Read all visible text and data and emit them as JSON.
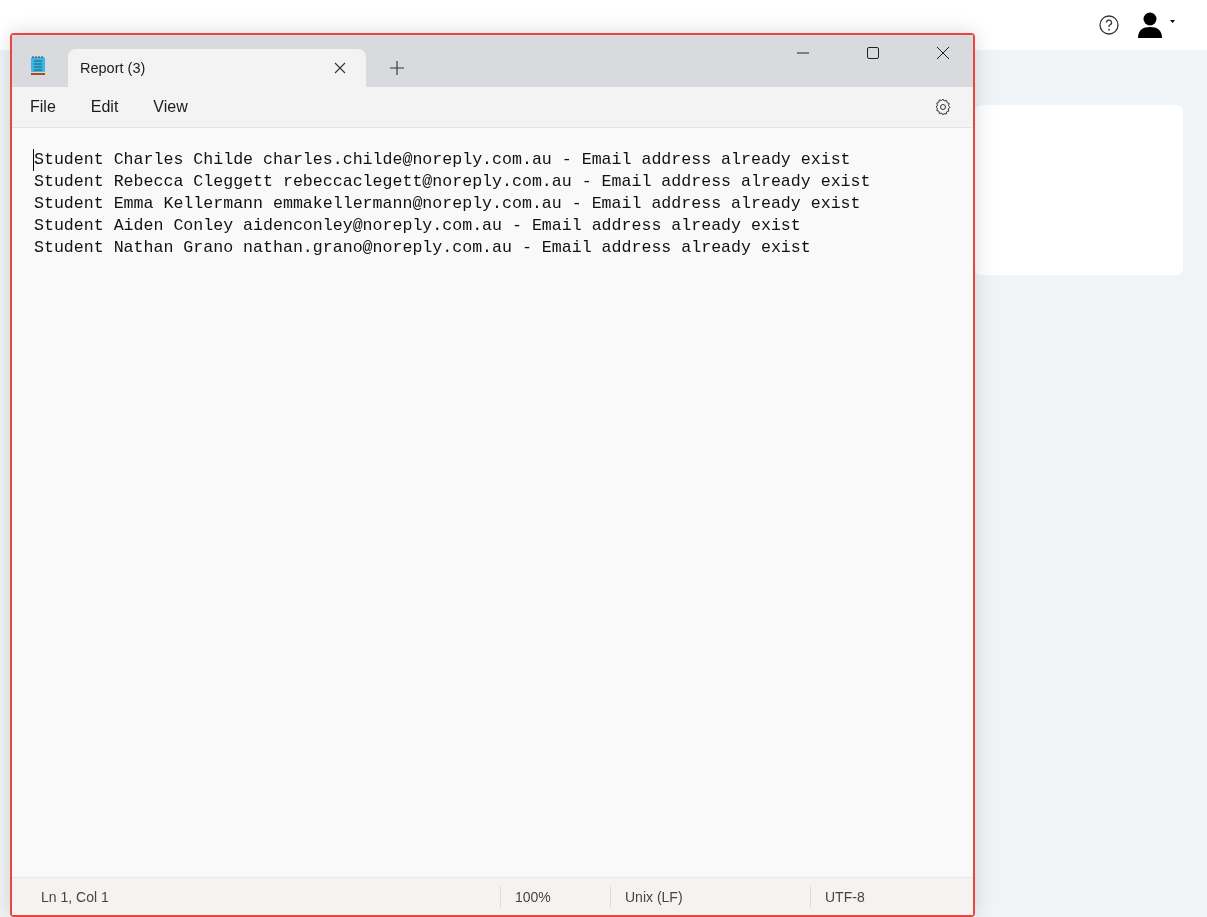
{
  "window": {
    "tab_title": "Report (3)",
    "tab_selected": true
  },
  "menu": [
    "File",
    "Edit",
    "View"
  ],
  "lines": [
    "Student Charles Childe charles.childe@noreply.com.au - Email address already exist",
    "Student Rebecca Cleggett rebeccaclegett@noreply.com.au - Email address already exist",
    "Student Emma Kellermann emmakellermann@noreply.com.au - Email address already exist",
    "Student Aiden Conley aidenconley@noreply.com.au - Email address already exist",
    "Student Nathan Grano nathan.grano@noreply.com.au - Email address already exist"
  ],
  "status_bar": [
    "Ln 1, Col 1",
    "100%",
    "Unix (LF)",
    "UTF-8"
  ]
}
